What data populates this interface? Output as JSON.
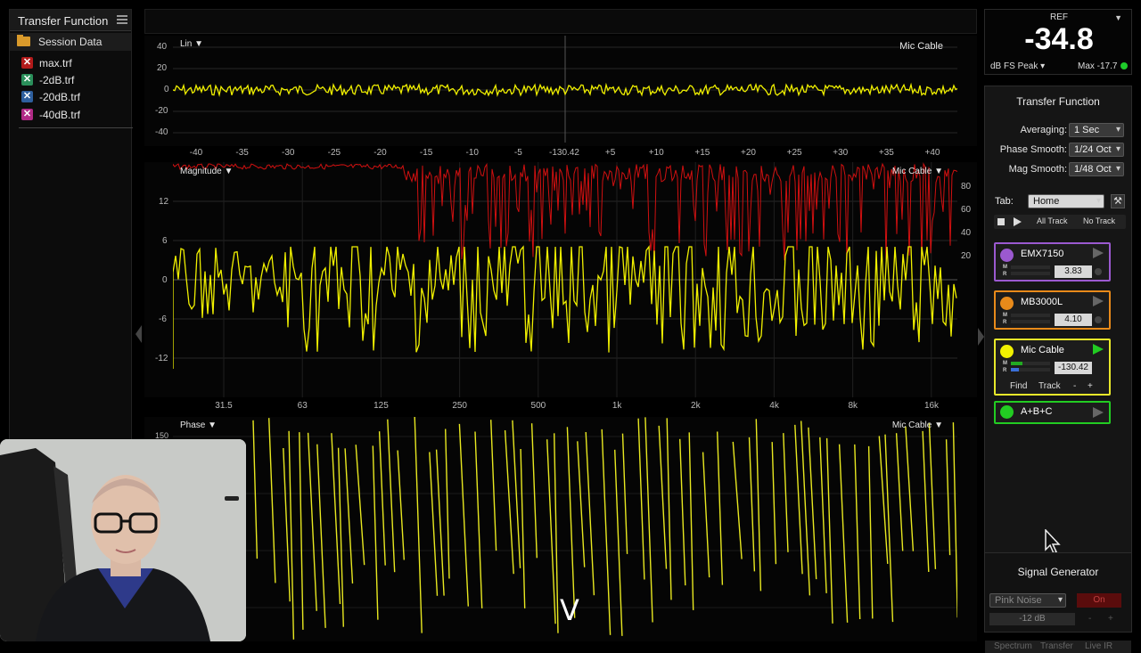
{
  "left_panel": {
    "title": "Transfer Function",
    "folder": "Session Data",
    "files": [
      {
        "name": "max.trf",
        "color": "#b21a1a"
      },
      {
        "name": "-2dB.trf",
        "color": "#2a8f5a"
      },
      {
        "name": "-20dB.trf",
        "color": "#2e5f9e"
      },
      {
        "name": "-40dB.trf",
        "color": "#b02a86"
      }
    ]
  },
  "live_ir": {
    "mode_label": "Lin",
    "trace_label": "Mic Cable",
    "y_ticks": [
      "40",
      "20",
      "0",
      "-20",
      "-40"
    ],
    "x_ticks": [
      "-40",
      "-35",
      "-30",
      "-25",
      "-20",
      "-15",
      "-10",
      "-5",
      "-130.42",
      "+5",
      "+10",
      "+15",
      "+20",
      "+25",
      "+30",
      "+35",
      "+40"
    ]
  },
  "magnitude": {
    "label": "Magnitude",
    "trace_label": "Mic Cable",
    "y_ticks": [
      "12",
      "6",
      "0",
      "-6",
      "-12"
    ],
    "coherence_ticks": [
      "80",
      "60",
      "40",
      "20"
    ],
    "x_ticks": [
      "31.5",
      "63",
      "125",
      "250",
      "500",
      "1k",
      "2k",
      "4k",
      "8k",
      "16k"
    ]
  },
  "phase": {
    "label": "Phase",
    "trace_label": "Mic Cable",
    "y_ticks": [
      "150"
    ]
  },
  "ref_meter": {
    "title": "REF",
    "value": "-34.8",
    "unit": "dB FS Peak",
    "max": "Max -17.7"
  },
  "tf_panel": {
    "title": "Transfer Function",
    "averaging_label": "Averaging:",
    "averaging": "1 Sec",
    "phase_smooth_label": "Phase Smooth:",
    "phase_smooth": "1/24 Oct",
    "mag_smooth_label": "Mag Smooth:",
    "mag_smooth": "1/48 Oct",
    "tab_label": "Tab:",
    "tab_value": "Home",
    "all_track": "All Track",
    "no_track": "No Track",
    "tracks": [
      {
        "name": "EMX7150",
        "value": "3.83",
        "color": "#9b59d0",
        "border": "#9b59d0"
      },
      {
        "name": "MB3000L",
        "value": "4.10",
        "color": "#e88a1a",
        "border": "#e88a1a"
      },
      {
        "name": "Mic Cable",
        "value": "-130.42",
        "color": "#f0f000",
        "border": "#e8e82a"
      },
      {
        "name": "A+B+C",
        "color": "#22cc22",
        "border": "#22cc22"
      }
    ],
    "find": "Find",
    "track": "Track",
    "minus": "-",
    "plus": "+"
  },
  "signal_generator": {
    "title": "Signal Generator",
    "type": "Pink Noise",
    "on": "On",
    "level": "-12 dB",
    "minus": "-",
    "plus": "+",
    "tabs": [
      "Spectrum",
      "Transfer",
      "Live IR"
    ]
  },
  "overlay_text": "V"
}
